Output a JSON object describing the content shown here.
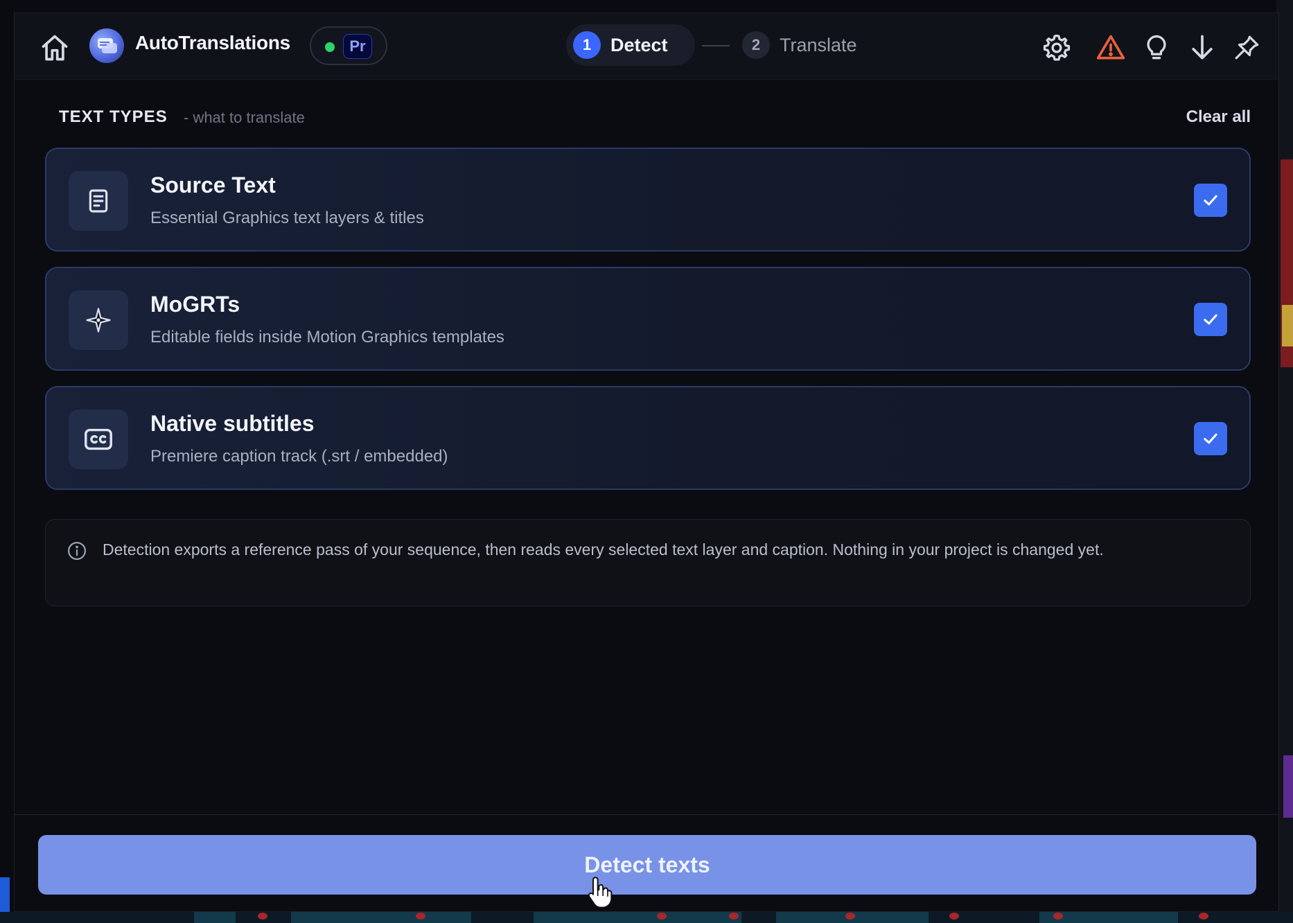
{
  "header": {
    "app_title": "AutoTranslations",
    "host_badge": "Pr",
    "steps": [
      {
        "number": "1",
        "label": "Detect",
        "active": true
      },
      {
        "number": "2",
        "label": "Translate",
        "active": false
      }
    ],
    "tools": [
      "gear-icon",
      "warning-icon",
      "lightbulb-icon",
      "download-arrow-icon",
      "pin-icon"
    ]
  },
  "section": {
    "title": "TEXT TYPES",
    "subtitle": "- what to translate",
    "clear_all": "Clear all"
  },
  "text_types": [
    {
      "title": "Source Text",
      "description": "Essential Graphics text layers & titles",
      "icon": "document-icon",
      "checked": true
    },
    {
      "title": "MoGRTs",
      "description": "Editable fields inside Motion Graphics templates",
      "icon": "sparkle-icon",
      "checked": true
    },
    {
      "title": "Native subtitles",
      "description": "Premiere caption track (.srt / embedded)",
      "icon": "closed-captions-icon",
      "checked": true
    }
  ],
  "info": {
    "text": "Detection exports a reference pass of your sequence, then reads every selected text layer and caption. Nothing in your project is changed yet."
  },
  "action": {
    "label": "Detect texts"
  },
  "colors": {
    "accent": "#3b6cf0",
    "button": "#7792e6",
    "status_online": "#2bd36a",
    "warning": "#e8613c"
  }
}
